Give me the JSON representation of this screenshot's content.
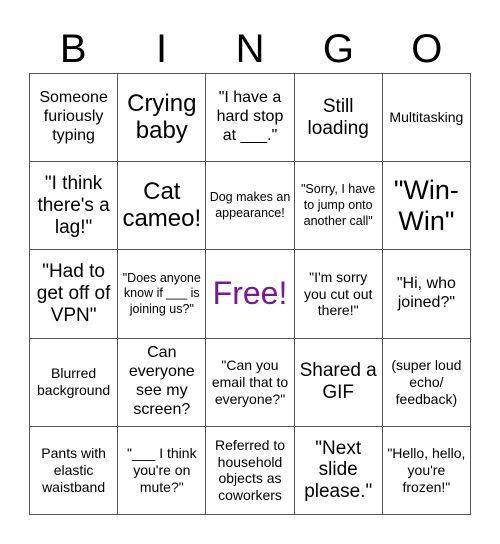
{
  "header": {
    "letters": [
      "B",
      "I",
      "N",
      "G",
      "O"
    ]
  },
  "colors": {
    "free_text": "#7a1a8f",
    "grid_line": "#555555"
  },
  "cells": [
    [
      "Someone furiously typing",
      "Crying baby",
      "\"I have a hard stop at ___.\"",
      "Still loading",
      "Multitasking"
    ],
    [
      "\"I think there's a lag!\"",
      "Cat cameo!",
      "Dog makes an appearance!",
      "\"Sorry, I have to jump onto another call\"",
      "\"Win-Win\""
    ],
    [
      "\"Had to get off of VPN\"",
      "\"Does anyone know if ___ is joining us?\"",
      "Free!",
      "\"I'm sorry you cut out there!\"",
      "\"Hi, who joined?\""
    ],
    [
      "Blurred background",
      "Can everyone see my screen?",
      "\"Can you email that to everyone?\"",
      "Shared a GIF",
      "(super loud echo/ feedback)"
    ],
    [
      "Pants with elastic waistband",
      "\"___ I think you're on mute?\"",
      "Referred to household objects as coworkers",
      "\"Next slide please.\"",
      "\"Hello, hello, you're frozen!\""
    ]
  ]
}
